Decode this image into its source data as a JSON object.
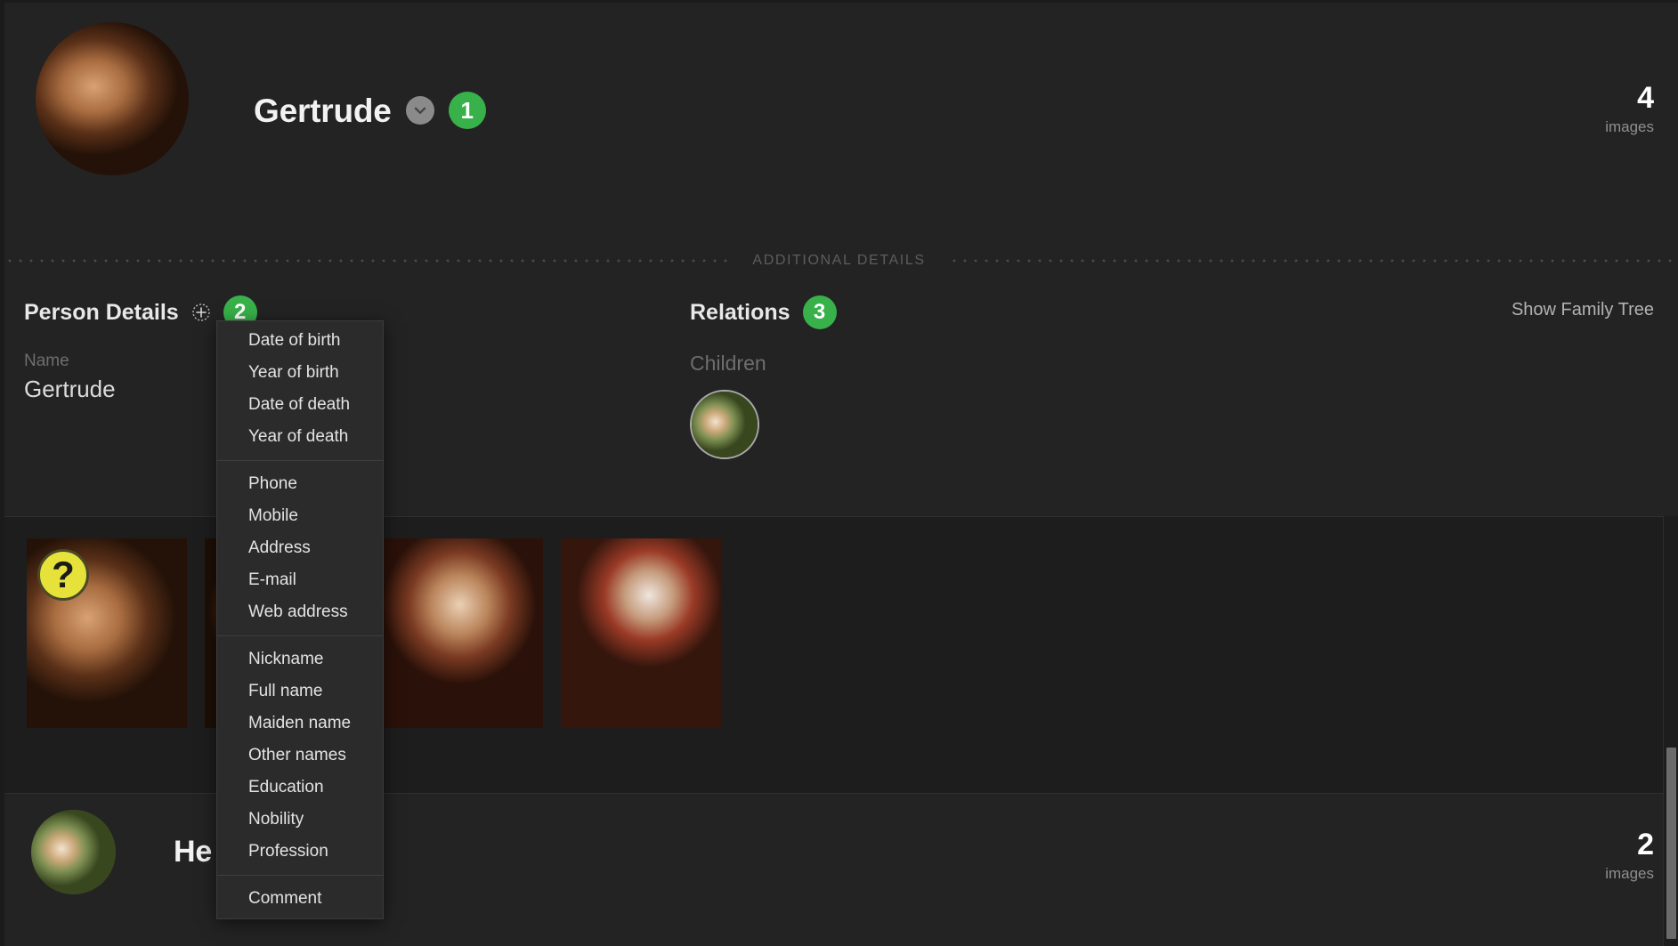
{
  "header": {
    "name": "Gertrude",
    "badge": "1",
    "chevron_icon": "chevron-down-icon",
    "avatar_icon": "person-portrait",
    "images_count": "4",
    "images_label": "images"
  },
  "divider": {
    "label": "ADDITIONAL DETAILS"
  },
  "person_details": {
    "title": "Person Details",
    "add_icon": "plus-circle-icon",
    "badge": "2",
    "fields": [
      {
        "label": "Name",
        "value": "Gertrude"
      }
    ]
  },
  "relations": {
    "title": "Relations",
    "badge": "3",
    "children_label": "Children",
    "children": [
      {
        "name": "child-avatar-1"
      }
    ],
    "family_tree_link": "Show Family Tree"
  },
  "photos": {
    "unknown_badge": "?",
    "items": [
      {
        "id": "photo-1",
        "has_unknown_badge": true
      },
      {
        "id": "photo-2",
        "has_unknown_badge": false
      },
      {
        "id": "photo-3",
        "has_unknown_badge": false
      },
      {
        "id": "photo-4",
        "has_unknown_badge": false
      }
    ]
  },
  "second_person": {
    "name": "He",
    "images_count": "2",
    "images_label": "images"
  },
  "dropdown": {
    "groups": [
      {
        "items": [
          "Date of birth",
          "Year of birth",
          "Date of death",
          "Year of death"
        ]
      },
      {
        "items": [
          "Phone",
          "Mobile",
          "Address",
          "E-mail",
          "Web address"
        ]
      },
      {
        "items": [
          "Nickname",
          "Full name",
          "Maiden name",
          "Other names",
          "Education",
          "Nobility",
          "Profession"
        ]
      },
      {
        "items": [
          "Comment"
        ]
      }
    ]
  },
  "colors": {
    "accent_green": "#38b14a",
    "unknown_yellow": "#e6e23a",
    "background": "#232323",
    "strip_background": "#1d1d1d"
  }
}
